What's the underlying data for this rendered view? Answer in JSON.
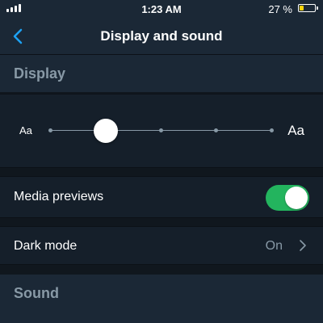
{
  "status_bar": {
    "time": "1:23 AM",
    "battery_percent": "27 %",
    "battery_level": 0.27
  },
  "nav": {
    "title": "Display and sound",
    "back_icon": "chevron-left-icon"
  },
  "display_section": {
    "header": "Display",
    "font_size": {
      "small_label": "Aa",
      "large_label": "Aa",
      "steps": 5,
      "selected_step": 1
    }
  },
  "media_previews": {
    "label": "Media previews",
    "enabled": true
  },
  "dark_mode": {
    "label": "Dark mode",
    "value": "On"
  },
  "sound_section": {
    "header": "Sound"
  },
  "colors": {
    "background": "#10171e",
    "header_bg": "#1b2836",
    "row_bg": "#151f2a",
    "accent": "#1da1f2",
    "toggle_on": "#23b45e",
    "secondary_text": "#8899a6",
    "battery_low": "#f5d20b"
  }
}
